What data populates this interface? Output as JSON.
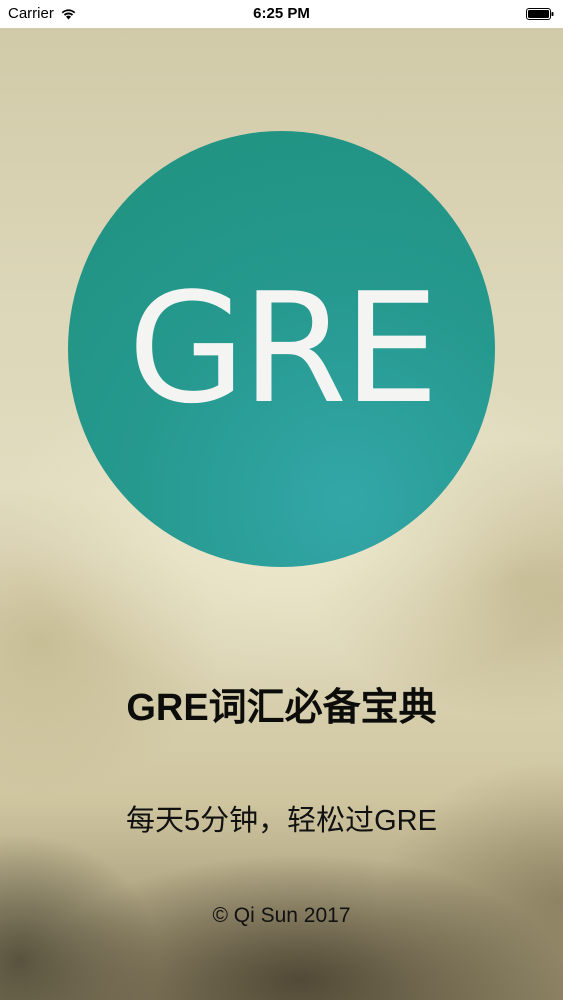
{
  "status_bar": {
    "carrier": "Carrier",
    "time": "6:25 PM",
    "wifi_icon": "wifi-icon",
    "battery_icon": "battery-icon"
  },
  "logo": {
    "text": "GRE",
    "circle_color": "#26998f",
    "text_color": "#f4f5f3"
  },
  "title": "GRE词汇必备宝典",
  "subtitle": "每天5分钟，轻松过GRE",
  "copyright": "© Qi Sun 2017"
}
